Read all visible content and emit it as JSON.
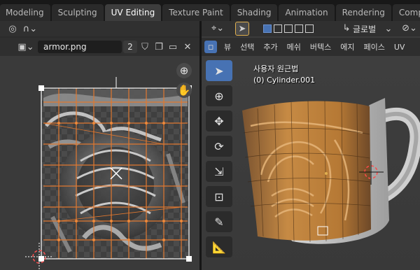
{
  "workspace_tabs": [
    "Modeling",
    "Sculpting",
    "UV Editing",
    "Texture Paint",
    "Shading",
    "Animation",
    "Rendering",
    "Compositi"
  ],
  "active_tab": "UV Editing",
  "uv_editor": {
    "image_name": "armor.png",
    "user_count": "2",
    "icons": [
      "view-icon",
      "curve-icon",
      "image-type-icon",
      "fake-user-shield-icon",
      "new-image-icon",
      "open-image-icon",
      "close-icon",
      "zoom-in-icon",
      "hand-pan-icon"
    ]
  },
  "viewport": {
    "menus": [
      "뷰",
      "선택",
      "추가",
      "메쉬",
      "버텍스",
      "에지",
      "페이스",
      "UV"
    ],
    "orientation": "글로벌",
    "view_name": "사용자 원근법",
    "object_info": "(0) Cylinder.001",
    "tools": [
      "select-box-tool",
      "cursor-tool",
      "move-tool",
      "rotate-tool",
      "scale-tool",
      "transform-tool",
      "annotate-tool",
      "measure-tool"
    ]
  },
  "colors": {
    "accent": "#4772b3",
    "uv_edge": "#e07830",
    "mug_texture": "#c68a44"
  }
}
